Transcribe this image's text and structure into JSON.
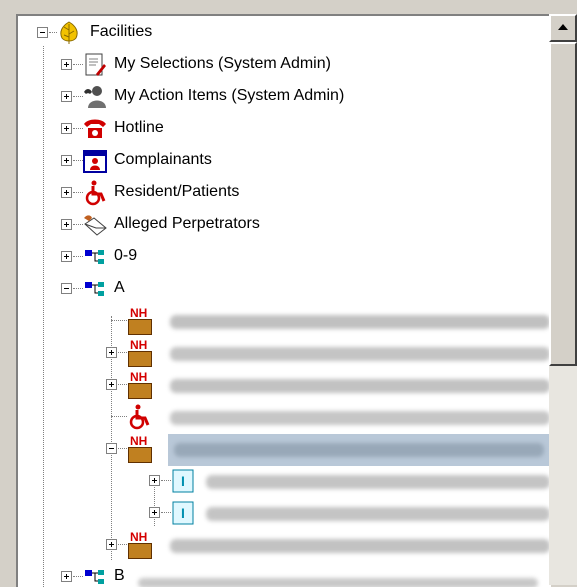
{
  "tree": {
    "root": {
      "label": "Facilities",
      "icon": "leaf-icon"
    },
    "groups": [
      {
        "label": "My Selections (System Admin)",
        "icon": "document-pen-icon"
      },
      {
        "label": "My Action Items (System Admin)",
        "icon": "phone-person-icon"
      },
      {
        "label": "Hotline",
        "icon": "red-telephone-icon"
      },
      {
        "label": "Complainants",
        "icon": "calendar-person-icon"
      },
      {
        "label": "Resident/Patients",
        "icon": "wheelchair-icon"
      },
      {
        "label": "Alleged Perpetrators",
        "icon": "envelope-hand-icon"
      },
      {
        "label": "0-9",
        "icon": "tree-branch-icon"
      },
      {
        "label": "A",
        "icon": "tree-branch-icon",
        "expanded": true
      },
      {
        "label": "B",
        "icon": "tree-branch-icon"
      }
    ],
    "facility_badge": "NH",
    "blurred_children_note": "facility names obscured in original"
  },
  "colors": {
    "window_bg": "#d4d0c8",
    "tree_bg": "#ffffff",
    "selection": "#b9c8d8",
    "badge_red": "#d40000"
  }
}
